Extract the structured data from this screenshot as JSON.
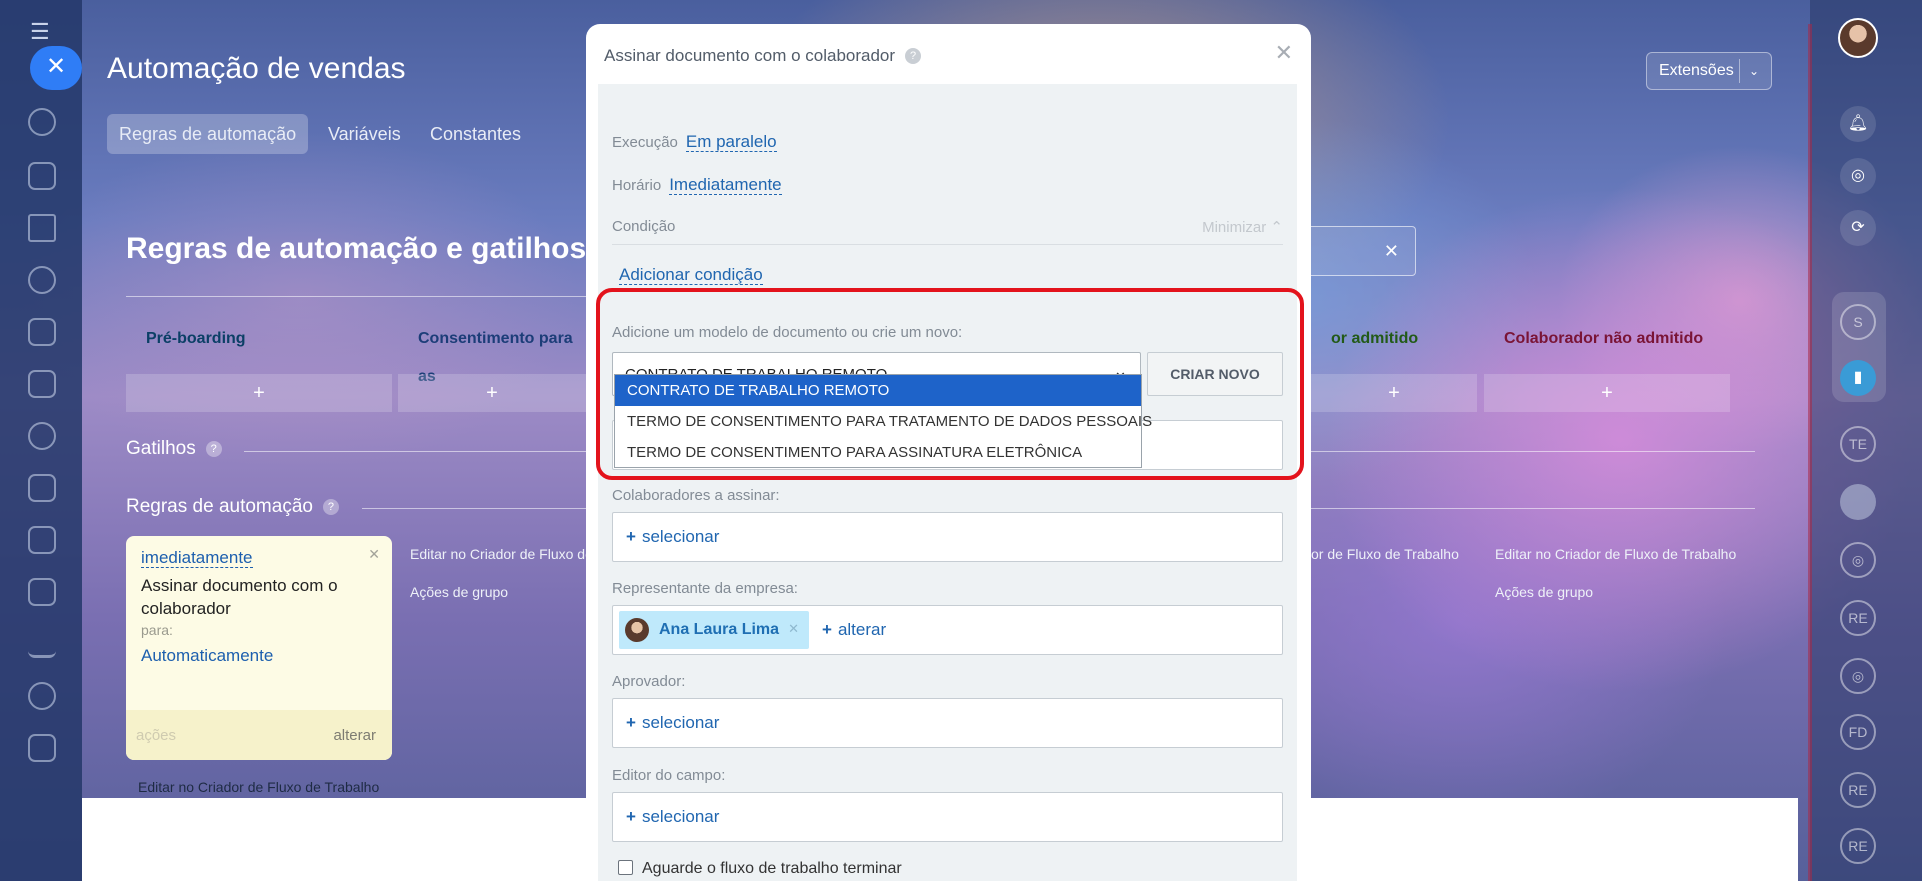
{
  "slider": {
    "title": "Automação de vendas",
    "tabs": [
      "Regras de automação",
      "Variáveis",
      "Constantes"
    ],
    "extensions_label": "Extensões",
    "section_title": "Regras de automação e gatilhos",
    "stages": [
      {
        "label": "Pré-boarding",
        "color": "#2fc6f6"
      },
      {
        "label": "Consentimento para as",
        "color": "#8fb8ff"
      },
      {
        "label": "or admitido",
        "color": "#7bd36a"
      },
      {
        "label": "Colaborador não admitido",
        "color": "#ff8fb5"
      }
    ],
    "add_symbol": "+",
    "triggers_label": "Gatilhos",
    "rules_label": "Regras de automação",
    "card": {
      "timing": "imediatamente",
      "name": "Assinar documento com o colaborador",
      "for_label": "para:",
      "target": "Automaticamente",
      "actions_label": "ações",
      "change_label": "alterar"
    },
    "edit_workflow": "Editar no Criador de Fluxo de Trabalho",
    "edit_workflow_cut": "Editar no Criador de Fluxo de",
    "group_actions": "Ações de grupo",
    "edit_workflow_right1": "or de Fluxo de Trabalho",
    "edit_workflow_right2": "Editar no Criador de Fluxo de Trabalho",
    "group_actions_right": "Ações de grupo"
  },
  "right_rail": {
    "initials": [
      "S",
      "TE",
      "RE",
      "FD",
      "RE",
      "RE"
    ]
  },
  "modal": {
    "title": "Assinar documento com o colaborador",
    "execution_label": "Execução",
    "execution_value": "Em paralelo",
    "time_label": "Horário",
    "time_value": "Imediatamente",
    "condition_label": "Condição",
    "minimize_label": "Minimizar",
    "add_condition": "Adicionar condição",
    "template_label": "Adicione um modelo de documento ou crie um novo:",
    "template_selected": "CONTRATO DE TRABALHO REMOTO",
    "create_new": "CRIAR NOVO",
    "template_options": [
      "CONTRATO DE TRABALHO REMOTO",
      "TERMO DE CONSENTIMENTO PARA TRATAMENTO DE DADOS PESSOAIS",
      "TERMO DE CONSENTIMENTO PARA ASSINATURA ELETRÔNICA"
    ],
    "signers_label": "Colaboradores a assinar:",
    "select_label": "selecionar",
    "company_rep_label": "Representante da empresa:",
    "company_rep_name": "Ana Laura Lima",
    "change_label": "alterar",
    "approver_label": "Aprovador:",
    "field_editor_label": "Editor do campo:",
    "wait_label": "Aguarde o fluxo de trabalho terminar"
  }
}
